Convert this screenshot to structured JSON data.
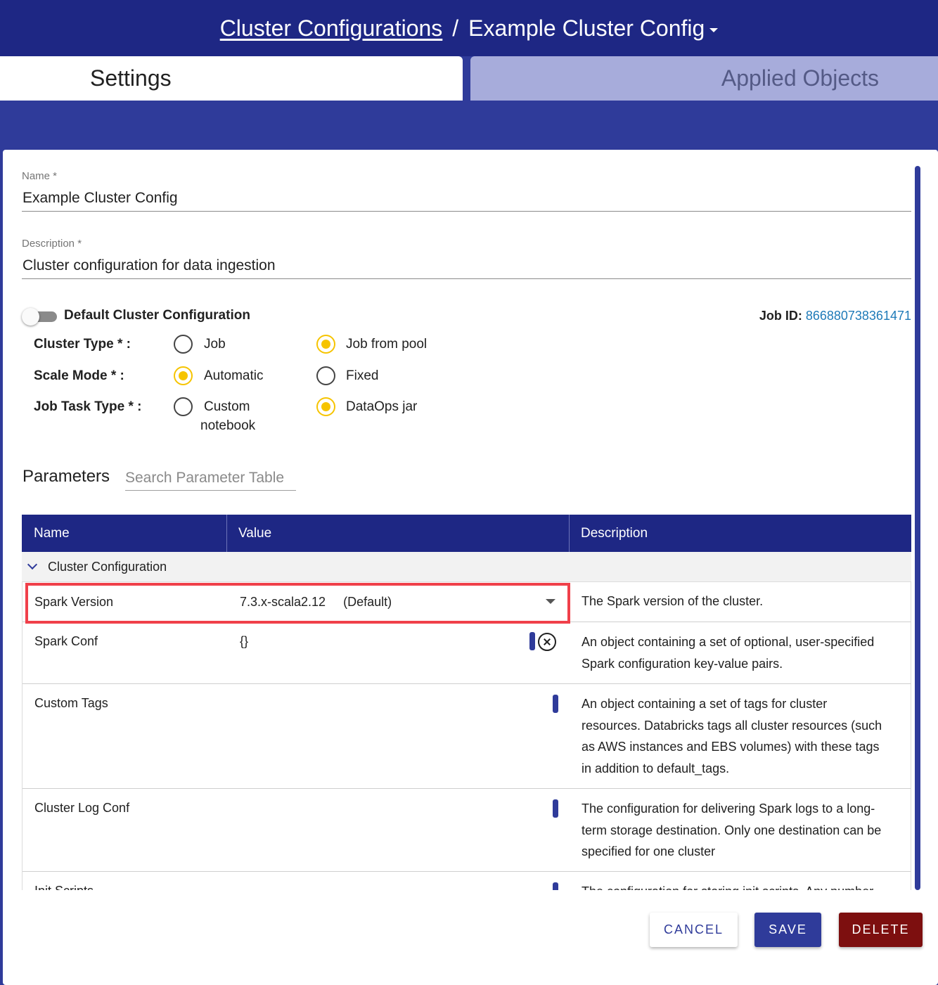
{
  "header": {
    "breadcrumb_link": "Cluster Configurations",
    "separator": "/",
    "title": "Example Cluster Config",
    "title_icon": "caret-down-icon"
  },
  "tabs": [
    {
      "label": "Settings",
      "active": true
    },
    {
      "label": "Applied Objects",
      "active": false
    }
  ],
  "form": {
    "name_label": "Name *",
    "name_value": "Example Cluster Config",
    "description_label": "Description *",
    "description_value": "Cluster configuration for data ingestion",
    "default_toggle_label": "Default Cluster Configuration",
    "default_toggle_on": false,
    "job_id_label": "Job ID:",
    "job_id_value": "866880738361471"
  },
  "options": {
    "cluster_type": {
      "label": "Cluster Type * :",
      "choices": [
        "Job",
        "Job from pool"
      ],
      "selected": "Job from pool"
    },
    "scale_mode": {
      "label": "Scale Mode * :",
      "choices": [
        "Automatic",
        "Fixed"
      ],
      "selected": "Automatic"
    },
    "job_task_type": {
      "label": "Job Task Type * :",
      "choices": [
        "Custom",
        "notebook",
        "DataOps jar"
      ],
      "selected": "DataOps jar"
    }
  },
  "parameters": {
    "title": "Parameters",
    "search_placeholder": "Search Parameter Table",
    "columns": [
      "Name",
      "Value",
      "Description"
    ],
    "group": "Cluster Configuration",
    "rows": [
      {
        "name": "Spark Version",
        "value": "7.3.x-scala2.12",
        "value_note": "(Default)",
        "description": [
          "The Spark version of the cluster."
        ]
      },
      {
        "name": "Spark Conf",
        "value": "{}",
        "description": [
          "An object containing a set of optional, user-specified",
          "Spark configuration key-value pairs."
        ]
      },
      {
        "name": "Custom Tags",
        "value": "",
        "description": [
          "An object containing a set of tags for cluster",
          "resources. Databricks tags all cluster resources (such",
          "as AWS instances and EBS volumes) with these tags",
          "in addition to default_tags."
        ]
      },
      {
        "name": "Cluster Log Conf",
        "value": "",
        "description": [
          "The configuration for delivering Spark logs to a long-",
          "term storage destination. Only one destination can be",
          "specified for one cluster"
        ]
      },
      {
        "name": "Init Scripts",
        "value": "",
        "description": [
          "The configuration for storing init scripts. Any number"
        ]
      }
    ]
  },
  "buttons": {
    "cancel": "CANCEL",
    "save": "SAVE",
    "delete": "DELETE"
  },
  "colors": {
    "header_bg": "#1e2784",
    "page_bg": "#2f3b9a",
    "radio_selected": "#f6c400",
    "highlight": "#f0404a",
    "delete_button": "#7d0f0f",
    "link": "#1e7ab8"
  }
}
